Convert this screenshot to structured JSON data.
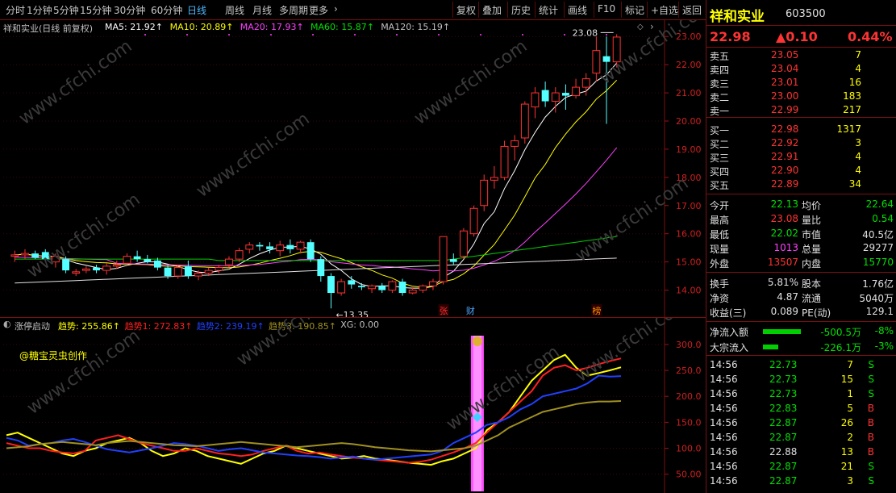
{
  "toolbar": {
    "left_tabs": [
      "分时",
      "1分钟",
      "5分钟",
      "15分钟",
      "30分钟",
      "60分钟",
      "日线",
      "周线",
      "月线",
      "多周期",
      "更多"
    ],
    "active_tab": "日线",
    "more_chevron": "›",
    "right_buttons": [
      "复权",
      "叠加",
      "历史",
      "统计",
      "画线",
      "F10",
      "标记",
      "+自选",
      "返回"
    ]
  },
  "main_chart": {
    "title": "祥和实业(日线 前复权)",
    "ma_legend": [
      {
        "label": "MA5: 21.92↑",
        "color": "#ffffff"
      },
      {
        "label": "MA10: 20.89↑",
        "color": "#ffff00"
      },
      {
        "label": "MA20: 17.93↑",
        "color": "#ff40ff"
      },
      {
        "label": "MA60: 15.87↑",
        "color": "#00e000"
      },
      {
        "label": "MA120: 15.19↑",
        "color": "#c0c0c0"
      }
    ],
    "high_mark": "23.08",
    "low_mark": "13.35",
    "tag_zhang": "张",
    "tag_cai": "财",
    "tag_bang": "榜",
    "price_axis": [
      "23.00",
      "22.00",
      "21.00",
      "20.00",
      "19.00",
      "18.00",
      "17.00",
      "16.00",
      "15.00",
      "14.00"
    ],
    "colors": {
      "up": "#ff3232",
      "down": "#54ffff",
      "grid": "#7a1010"
    },
    "candles": [
      [
        15.2,
        15.4,
        15.0,
        15.25
      ],
      [
        15.25,
        15.45,
        15.1,
        15.3
      ],
      [
        15.3,
        15.4,
        15.1,
        15.15
      ],
      [
        15.35,
        15.45,
        15.05,
        15.1
      ],
      [
        15.0,
        15.3,
        14.8,
        15.2
      ],
      [
        15.1,
        15.2,
        14.6,
        14.7
      ],
      [
        14.6,
        14.75,
        14.5,
        14.65
      ],
      [
        14.7,
        14.85,
        14.6,
        14.75
      ],
      [
        14.8,
        14.9,
        14.6,
        14.7
      ],
      [
        14.7,
        14.95,
        14.55,
        14.85
      ],
      [
        14.85,
        15.05,
        14.75,
        14.9
      ],
      [
        14.95,
        15.3,
        14.9,
        15.2
      ],
      [
        15.2,
        15.4,
        15.0,
        15.1
      ],
      [
        15.1,
        15.25,
        14.95,
        15.0
      ],
      [
        15.05,
        15.15,
        14.7,
        14.8
      ],
      [
        14.8,
        14.9,
        14.4,
        14.5
      ],
      [
        14.5,
        14.9,
        14.4,
        14.8
      ],
      [
        14.85,
        15.05,
        14.4,
        14.5
      ],
      [
        14.5,
        14.7,
        14.35,
        14.6
      ],
      [
        14.6,
        14.8,
        14.5,
        14.7
      ],
      [
        14.7,
        14.9,
        14.6,
        14.8
      ],
      [
        14.9,
        15.2,
        14.8,
        15.1
      ],
      [
        15.1,
        15.5,
        15.0,
        15.4
      ],
      [
        15.45,
        15.7,
        15.3,
        15.6
      ],
      [
        15.6,
        15.7,
        15.4,
        15.55
      ],
      [
        15.55,
        15.7,
        15.3,
        15.45
      ],
      [
        15.4,
        15.75,
        15.2,
        15.6
      ],
      [
        15.6,
        15.8,
        15.3,
        15.45
      ],
      [
        15.45,
        15.75,
        15.3,
        15.7
      ],
      [
        15.7,
        15.8,
        15.0,
        15.1
      ],
      [
        15.1,
        15.2,
        14.3,
        14.5
      ],
      [
        14.5,
        14.6,
        13.35,
        13.9
      ],
      [
        13.9,
        14.4,
        13.8,
        14.3
      ],
      [
        14.35,
        14.5,
        14.05,
        14.2
      ],
      [
        14.15,
        14.25,
        14.0,
        14.1
      ],
      [
        14.05,
        14.2,
        13.9,
        14.15
      ],
      [
        14.15,
        14.25,
        13.9,
        14.0
      ],
      [
        14.0,
        14.35,
        13.9,
        14.3
      ],
      [
        14.3,
        14.4,
        13.8,
        13.9
      ],
      [
        13.9,
        14.1,
        13.85,
        14.0
      ],
      [
        14.0,
        14.2,
        13.9,
        14.15
      ],
      [
        14.15,
        14.4,
        14.0,
        14.3
      ],
      [
        14.3,
        15.9,
        14.2,
        15.9
      ],
      [
        15.1,
        15.3,
        14.9,
        15.0
      ],
      [
        15.2,
        16.2,
        15.1,
        16.1
      ],
      [
        16.0,
        17.0,
        15.9,
        16.9
      ],
      [
        17.0,
        18.1,
        16.8,
        17.9
      ],
      [
        17.9,
        18.4,
        17.6,
        18.0
      ],
      [
        18.0,
        19.3,
        17.9,
        19.1
      ],
      [
        19.1,
        19.5,
        18.6,
        19.3
      ],
      [
        19.4,
        20.7,
        19.2,
        20.6
      ],
      [
        20.5,
        21.2,
        20.1,
        21.0
      ],
      [
        21.1,
        21.4,
        20.5,
        20.7
      ],
      [
        20.7,
        21.2,
        20.3,
        21.0
      ],
      [
        21.0,
        21.3,
        20.4,
        20.9
      ],
      [
        20.9,
        21.5,
        20.8,
        21.2
      ],
      [
        21.2,
        21.7,
        20.9,
        21.5
      ],
      [
        21.7,
        23.0,
        21.4,
        22.5
      ],
      [
        22.3,
        23.0,
        19.9,
        22.1
      ],
      [
        22.1,
        23.08,
        21.9,
        22.98
      ]
    ]
  },
  "indicator": {
    "title": "涨停启动",
    "legend": [
      {
        "label": "趋势: 255.86↑",
        "color": "#ffff00"
      },
      {
        "label": "趋势1: 272.83↑",
        "color": "#ff2020"
      },
      {
        "label": "趋势2: 239.19↑",
        "color": "#2040ff"
      },
      {
        "label": "趋势3: 190.85↑",
        "color": "#a09020"
      },
      {
        "label": "XG: 0.00",
        "color": "#c0c0c0"
      }
    ],
    "watermark_text": "@糖宝灵虫创作",
    "axis": [
      "300.0",
      "250.0",
      "200.0",
      "150.0",
      "100.0",
      "50.00"
    ],
    "trend": [
      125,
      130,
      120,
      110,
      100,
      90,
      85,
      95,
      100,
      110,
      115,
      120,
      110,
      95,
      85,
      90,
      100,
      95,
      85,
      80,
      75,
      70,
      80,
      90,
      95,
      105,
      100,
      95,
      90,
      85,
      80,
      82,
      85,
      80,
      78,
      75,
      72,
      70,
      68,
      75,
      80,
      90,
      100,
      135,
      150,
      170,
      200,
      230,
      250,
      270,
      280,
      255,
      240,
      245,
      250,
      256
    ],
    "trend1": [
      110,
      105,
      100,
      100,
      95,
      92,
      90,
      95,
      115,
      120,
      125,
      118,
      110,
      105,
      100,
      95,
      95,
      100,
      95,
      90,
      88,
      85,
      88,
      95,
      100,
      105,
      95,
      90,
      92,
      88,
      85,
      82,
      80,
      78,
      76,
      74,
      72,
      74,
      78,
      85,
      92,
      100,
      110,
      130,
      150,
      170,
      190,
      210,
      240,
      255,
      260,
      250,
      255,
      262,
      268,
      273
    ],
    "trend2": [
      120,
      115,
      105,
      108,
      110,
      115,
      118,
      112,
      105,
      98,
      95,
      92,
      96,
      100,
      105,
      110,
      108,
      105,
      100,
      95,
      98,
      100,
      96,
      92,
      90,
      88,
      86,
      85,
      83,
      80,
      82,
      84,
      80,
      78,
      80,
      82,
      84,
      86,
      88,
      95,
      110,
      120,
      130,
      145,
      150,
      160,
      175,
      185,
      200,
      205,
      210,
      215,
      225,
      240,
      238,
      239
    ],
    "trend3": [
      100,
      102,
      104,
      108,
      110,
      112,
      110,
      108,
      106,
      110,
      112,
      114,
      112,
      110,
      108,
      106,
      105,
      104,
      106,
      108,
      110,
      112,
      110,
      108,
      106,
      104,
      102,
      104,
      106,
      108,
      110,
      108,
      105,
      102,
      100,
      98,
      96,
      95,
      94,
      96,
      98,
      100,
      105,
      115,
      125,
      140,
      150,
      160,
      170,
      175,
      180,
      185,
      188,
      190,
      190,
      191
    ],
    "signal_label": "XG"
  },
  "quote": {
    "name": "祥和实业",
    "code": "603500",
    "price": "22.98",
    "change": "▲0.10",
    "change_pct": "0.44%",
    "asks": [
      {
        "label": "卖五",
        "price": "23.05",
        "vol": "7"
      },
      {
        "label": "卖四",
        "price": "23.04",
        "vol": "4"
      },
      {
        "label": "卖三",
        "price": "23.01",
        "vol": "16"
      },
      {
        "label": "卖二",
        "price": "23.00",
        "vol": "183"
      },
      {
        "label": "卖一",
        "price": "22.99",
        "vol": "217"
      }
    ],
    "bids": [
      {
        "label": "买一",
        "price": "22.98",
        "vol": "1317"
      },
      {
        "label": "买二",
        "price": "22.92",
        "vol": "3"
      },
      {
        "label": "买三",
        "price": "22.91",
        "vol": "4"
      },
      {
        "label": "买四",
        "price": "22.90",
        "vol": "4"
      },
      {
        "label": "买五",
        "price": "22.89",
        "vol": "34"
      }
    ],
    "stats": [
      {
        "l1": "今开",
        "v1": "22.13",
        "c1": "green",
        "l2": "均价",
        "v2": "22.64",
        "c2": "green"
      },
      {
        "l1": "最高",
        "v1": "23.08",
        "c1": "red",
        "l2": "量比",
        "v2": "0.54",
        "c2": "green"
      },
      {
        "l1": "最低",
        "v1": "22.02",
        "c1": "green",
        "l2": "市值",
        "v2": "40.5亿",
        "c2": "white"
      },
      {
        "l1": "现量",
        "v1": "1013",
        "c1": "magenta",
        "l2": "总量",
        "v2": "29277",
        "c2": "white"
      },
      {
        "l1": "外盘",
        "v1": "13507",
        "c1": "red",
        "l2": "内盘",
        "v2": "15770",
        "c2": "green"
      }
    ],
    "stats2": [
      {
        "l1": "换手",
        "v1": "5.81%",
        "l2": "股本",
        "v2": "1.76亿"
      },
      {
        "l1": "净资",
        "v1": "4.87",
        "l2": "流通",
        "v2": "5040万"
      },
      {
        "l1": "收益(三)",
        "v1": "0.089",
        "l2": "PE(动)",
        "v2": "129.1"
      }
    ],
    "flows": [
      {
        "label": "净流入额",
        "value": "-500.5万",
        "pct": "-8%",
        "bar_fraction": 0.85
      },
      {
        "label": "大宗流入",
        "value": "-226.1万",
        "pct": "-3%",
        "bar_fraction": 0.35
      }
    ],
    "ticks": [
      {
        "time": "14:56",
        "price": "22.73",
        "vol": "7",
        "side": "S"
      },
      {
        "time": "14:56",
        "price": "22.73",
        "vol": "15",
        "side": "S"
      },
      {
        "time": "14:56",
        "price": "22.73",
        "vol": "1",
        "side": "S"
      },
      {
        "time": "14:56",
        "price": "22.83",
        "vol": "5",
        "side": "B"
      },
      {
        "time": "14:56",
        "price": "22.87",
        "vol": "26",
        "side": "B"
      },
      {
        "time": "14:56",
        "price": "22.87",
        "vol": "2",
        "side": "B"
      },
      {
        "time": "14:56",
        "price": "22.88",
        "vol": "13",
        "side": "B"
      },
      {
        "time": "14:56",
        "price": "22.87",
        "vol": "21",
        "side": "S"
      },
      {
        "time": "14:56",
        "price": "22.87",
        "vol": "3",
        "side": "S"
      }
    ]
  },
  "watermark": "www.cfchi.com"
}
